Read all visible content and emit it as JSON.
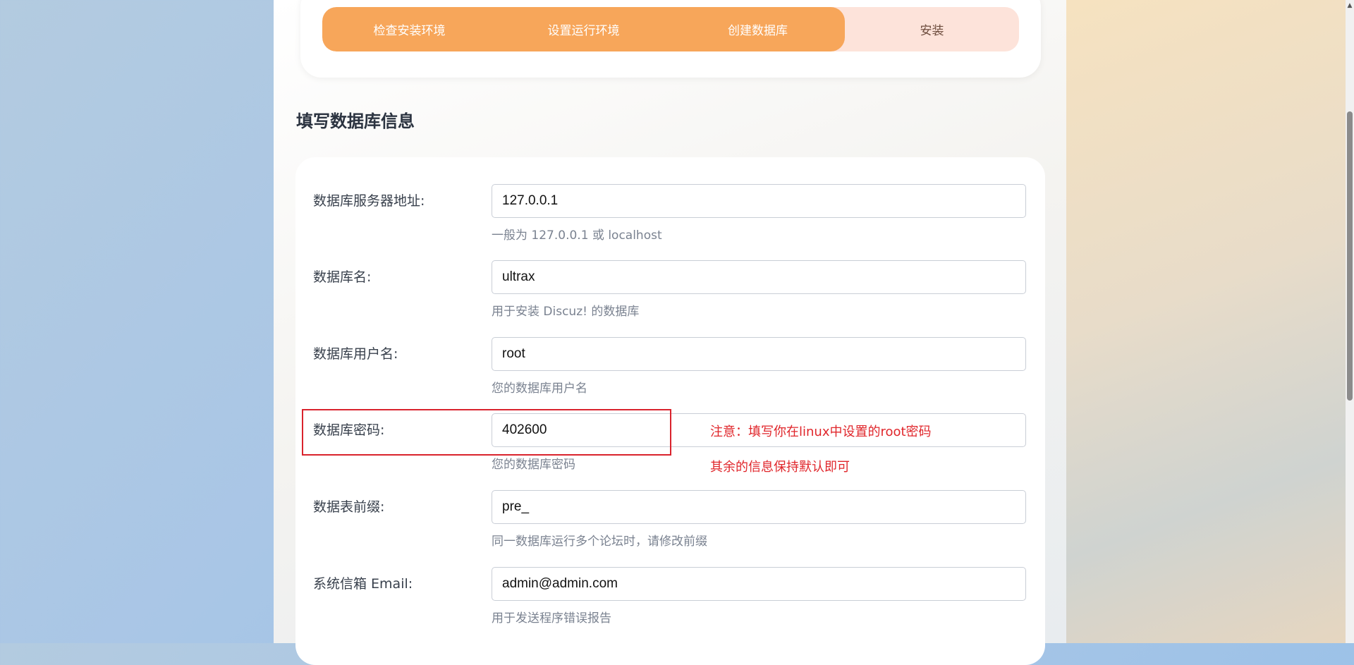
{
  "steps": [
    {
      "label": "检查安装环境",
      "state": "done"
    },
    {
      "label": "设置运行环境",
      "state": "done"
    },
    {
      "label": "创建数据库",
      "state": "done"
    },
    {
      "label": "安装",
      "state": "current"
    }
  ],
  "section_title": "填写数据库信息",
  "form": {
    "db_host": {
      "label": "数据库服务器地址:",
      "value": "127.0.0.1",
      "hint": "一般为 127.0.0.1 或 localhost"
    },
    "db_name": {
      "label": "数据库名:",
      "value": "ultrax",
      "hint": "用于安装 Discuz! 的数据库"
    },
    "db_user": {
      "label": "数据库用户名:",
      "value": "root",
      "hint": "您的数据库用户名"
    },
    "db_password": {
      "label": "数据库密码:",
      "value": "402600",
      "hint": "您的数据库密码"
    },
    "table_prefix": {
      "label": "数据表前缀:",
      "value": "pre_",
      "hint": "同一数据库运行多个论坛时，请修改前缀"
    },
    "admin_email": {
      "label": "系统信箱 Email:",
      "value": "admin@admin.com",
      "hint": "用于发送程序错误报告"
    }
  },
  "annotations": {
    "note_1": "注意：填写你在linux中设置的root密码",
    "note_2": "其余的信息保持默认即可"
  },
  "colors": {
    "step_done": "#f7a65a",
    "step_pending": "#fde3da",
    "annotation_red": "#e0262b"
  }
}
